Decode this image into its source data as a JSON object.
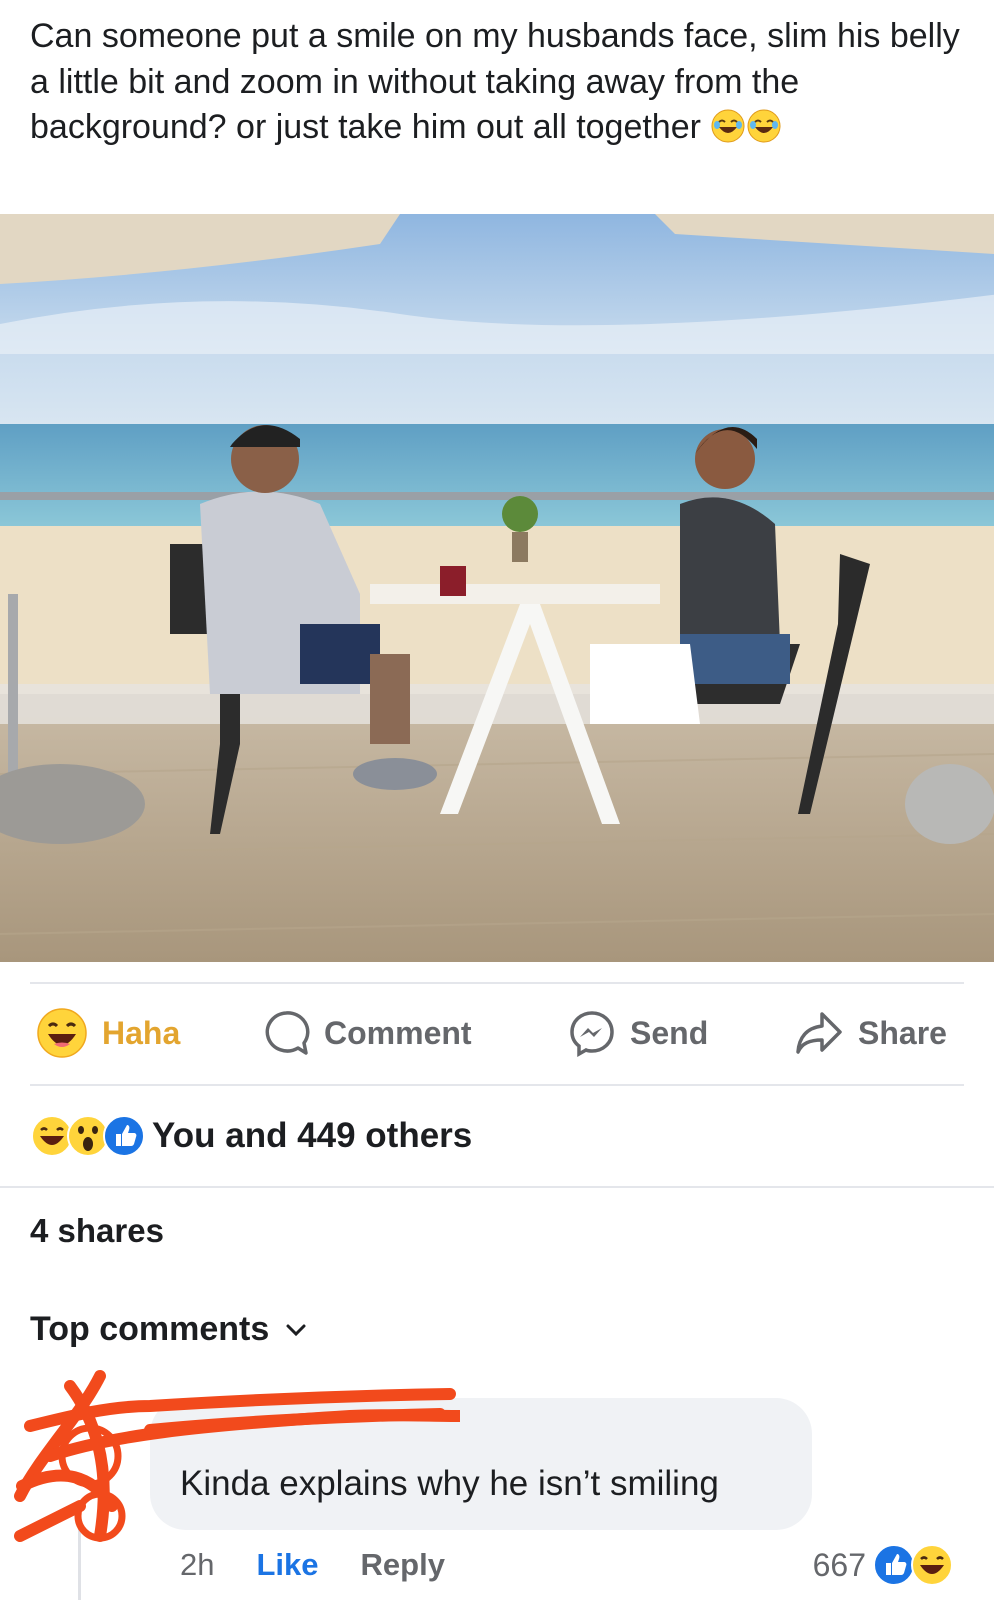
{
  "post": {
    "text": "Can someone put a smile on my husbands face, slim his belly a little bit and zoom in without taking away from the background? or just take him out all together",
    "text_emojis": [
      "haha-laughing-emoji",
      "haha-laughing-emoji"
    ]
  },
  "actions": {
    "haha_label": "Haha",
    "comment_label": "Comment",
    "send_label": "Send",
    "share_label": "Share"
  },
  "reactions": {
    "summary": "You and 449 others",
    "icons": [
      "haha-reaction-icon",
      "wow-reaction-icon",
      "like-reaction-icon"
    ]
  },
  "shares": "4 shares",
  "comments_filter": "Top comments",
  "comment": {
    "author": "",
    "text": "Kinda explains why he isn’t smiling",
    "time": "2h",
    "like_label": "Like",
    "reply_label": "Reply",
    "reaction_count": "667"
  },
  "colors": {
    "haha_yellow": "#e3a52f",
    "like_blue": "#1b74e4",
    "secondary_text": "#65676b",
    "bubble_bg": "#f0f2f5",
    "redaction_red": "#f24a1c"
  }
}
